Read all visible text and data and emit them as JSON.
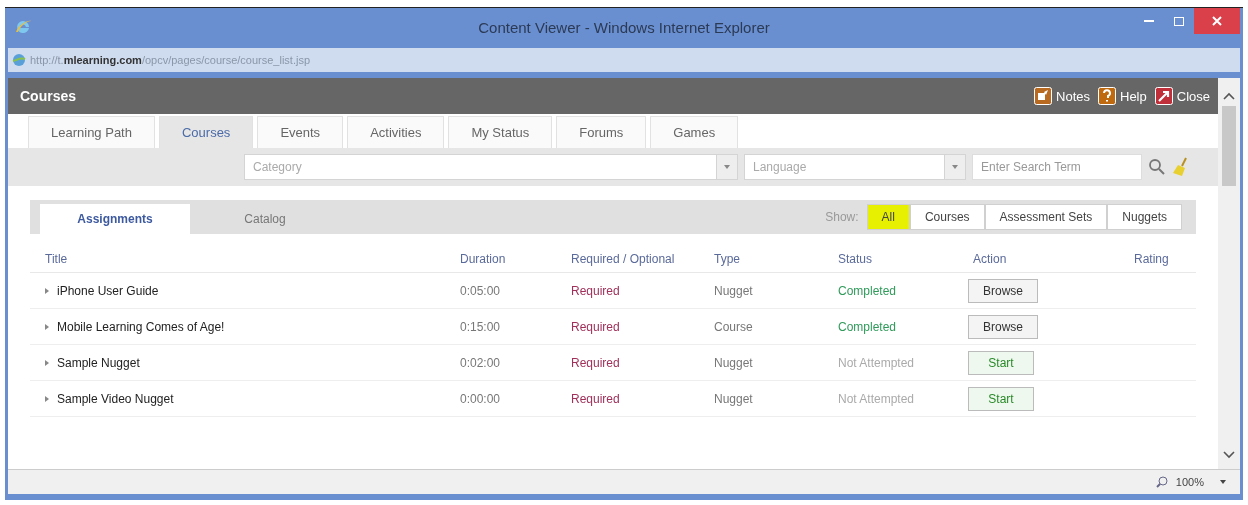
{
  "window": {
    "title": "Content Viewer - Windows Internet Explorer"
  },
  "address_bar": {
    "prefix": "http://t.",
    "domain": "mlearning.com",
    "path": "/opcv/pages/course/course_list.jsp"
  },
  "header": {
    "title": "Courses",
    "actions": [
      {
        "kind": "notes",
        "label": "Notes"
      },
      {
        "kind": "help",
        "label": "Help"
      },
      {
        "kind": "close",
        "label": "Close"
      }
    ]
  },
  "tabs": [
    {
      "label": "Learning Path",
      "selected": false
    },
    {
      "label": "Courses",
      "selected": true
    },
    {
      "label": "Events",
      "selected": false
    },
    {
      "label": "Activities",
      "selected": false
    },
    {
      "label": "My Status",
      "selected": false
    },
    {
      "label": "Forums",
      "selected": false
    },
    {
      "label": "Games",
      "selected": false
    }
  ],
  "filters": {
    "category": {
      "placeholder": "Category"
    },
    "language": {
      "placeholder": "Language"
    },
    "search": {
      "placeholder": "Enter Search Term"
    }
  },
  "sub_tabs": [
    {
      "label": "Assignments",
      "selected": true
    },
    {
      "label": "Catalog",
      "selected": false
    }
  ],
  "show": {
    "label": "Show:",
    "options": [
      {
        "label": "All",
        "selected": true
      },
      {
        "label": "Courses",
        "selected": false
      },
      {
        "label": "Assessment Sets",
        "selected": false
      },
      {
        "label": "Nuggets",
        "selected": false
      }
    ]
  },
  "table": {
    "columns": [
      "Title",
      "Duration",
      "Required / Optional",
      "Type",
      "Status",
      "Action",
      "Rating"
    ],
    "rows": [
      {
        "title": "iPhone User Guide",
        "duration": "0:05:00",
        "requirement": "Required",
        "type": "Nugget",
        "status": {
          "text": "Completed",
          "kind": "completed"
        },
        "action": {
          "label": "Browse",
          "kind": "browse"
        }
      },
      {
        "title": "Mobile Learning Comes of Age!",
        "duration": "0:15:00",
        "requirement": "Required",
        "type": "Course",
        "status": {
          "text": "Completed",
          "kind": "completed"
        },
        "action": {
          "label": "Browse",
          "kind": "browse"
        }
      },
      {
        "title": "Sample Nugget",
        "duration": "0:02:00",
        "requirement": "Required",
        "type": "Nugget",
        "status": {
          "text": "Not Attempted",
          "kind": "not_attempted"
        },
        "action": {
          "label": "Start",
          "kind": "start"
        }
      },
      {
        "title": "Sample Video Nugget",
        "duration": "0:00:00",
        "requirement": "Required",
        "type": "Nugget",
        "status": {
          "text": "Not Attempted",
          "kind": "not_attempted"
        },
        "action": {
          "label": "Start",
          "kind": "start"
        }
      }
    ]
  },
  "status_bar": {
    "zoom": "100%"
  }
}
